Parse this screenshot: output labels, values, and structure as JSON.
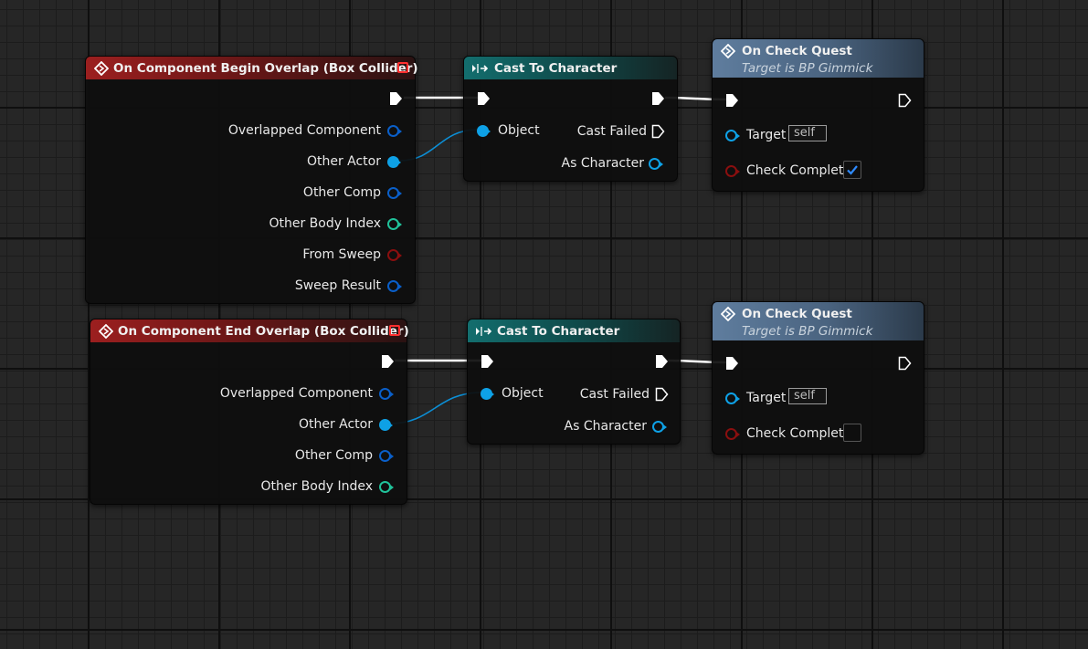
{
  "colors": {
    "exec": "#ffffff",
    "object_pin": "#0ea1e6",
    "object_pin_dark": "#0a5fc9",
    "int_pin": "#20c29a",
    "bool_pin": "#8a0f0f",
    "wire_blue": "#0c8fd6"
  },
  "nodes": {
    "begin_overlap": {
      "title": "On Component Begin Overlap (Box Collider)",
      "pins": [
        "Overlapped Component",
        "Other Actor",
        "Other Comp",
        "Other Body Index",
        "From Sweep",
        "Sweep Result"
      ]
    },
    "end_overlap": {
      "title": "On Component End Overlap (Box Collider)",
      "pins": [
        "Overlapped Component",
        "Other Actor",
        "Other Comp",
        "Other Body Index"
      ]
    },
    "cast1": {
      "title": "Cast To Character",
      "object": "Object",
      "cast_failed": "Cast Failed",
      "as_character": "As Character"
    },
    "cast2": {
      "title": "Cast To Character",
      "object": "Object",
      "cast_failed": "Cast Failed",
      "as_character": "As Character"
    },
    "quest1": {
      "title": "On Check Quest",
      "subtitle": "Target is BP Gimmick",
      "target": "Target",
      "target_value": "self",
      "check_complete": "Check Complete",
      "checked": true
    },
    "quest2": {
      "title": "On Check Quest",
      "subtitle": "Target is BP Gimmick",
      "target": "Target",
      "target_value": "self",
      "check_complete": "Check Complete",
      "checked": false
    }
  }
}
